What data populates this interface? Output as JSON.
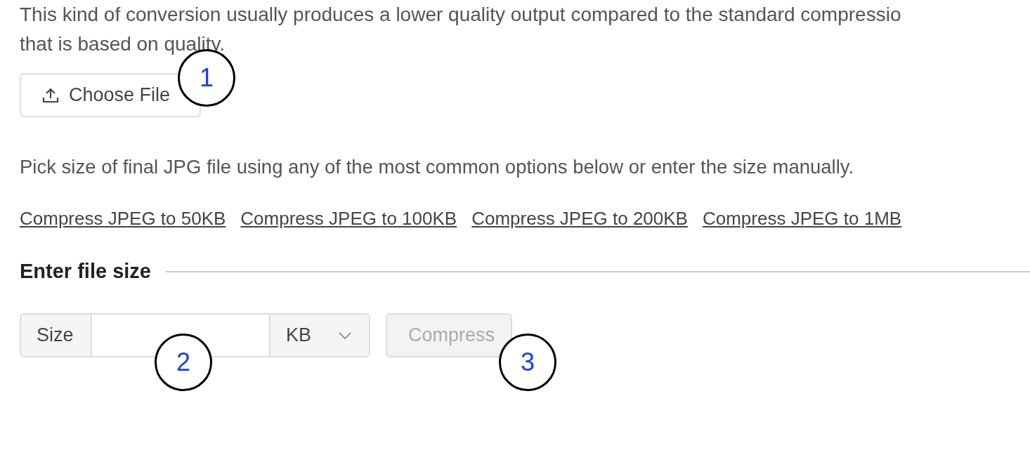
{
  "intro": [
    "This kind of conversion usually produces a lower quality output compared to the standard compressio",
    "that is based on quality."
  ],
  "choose_button": {
    "label": "Choose File"
  },
  "pick_text": "Pick size of final JPG file using any of the most common options below or enter the size manually.",
  "links": [
    "Compress JPEG to 50KB",
    "Compress JPEG to 100KB",
    "Compress JPEG to 200KB",
    "Compress JPEG to 1MB"
  ],
  "section_title": "Enter file size",
  "size_form": {
    "label": "Size",
    "unit": "KB",
    "button": {
      "label": "Compress",
      "disabled": true
    }
  },
  "callouts": [
    "1",
    "2",
    "3"
  ]
}
